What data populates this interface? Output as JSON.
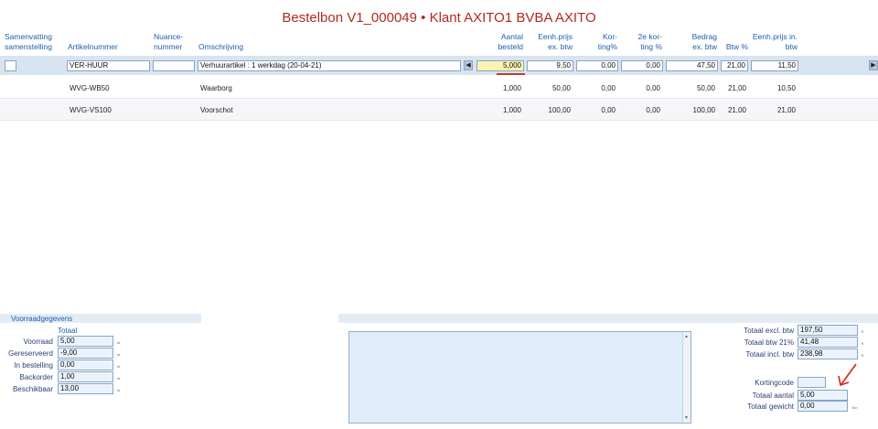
{
  "title": "Bestelbon V1_000049 • Klant AXITO1 BVBA AXITO",
  "columns": {
    "samenvatting": "Samenvatting samenstelling",
    "artikelnummer": "Artikelnummer",
    "nuance": "Nuance-nummer",
    "omschrijving": "Omschrijving",
    "aantal": "Aantal besteld",
    "eenhprijs": "Eenh.prijs ex. btw",
    "korting": "Kor-ting%",
    "korting2": "2e kor-ting %",
    "bedrag": "Bedrag ex. btw",
    "btw": "Btw %",
    "eenhprijs_in": "Eenh.prijs in. btw"
  },
  "subheaders": {
    "samenvatting": "Samenvatting samenstelling",
    "artikelnummer": "Artikelnummer (F5)",
    "nuance": "Nuancenummer",
    "omschrijving": "Omschrijving",
    "aantal": "Aantal besteld",
    "eenhprijs": "Eenh.prijs ex. btw",
    "korting": "Korting%",
    "korting2": "2e korting %",
    "bedrag": "Bedrag ex. btw",
    "btw": "Btw %",
    "eenhprijs_in": "Eenh.prijs in. btw"
  },
  "edit_row": {
    "artikelnummer": "VER-HUUR",
    "nuance": "",
    "omschrijving": "Verhuurartikel : 1 werkdag (20-04-21)",
    "aantal": "5,000",
    "eenhprijs": "9,50",
    "korting": "0,00",
    "korting2": "0,00",
    "bedrag": "47,50",
    "btw": "21,00",
    "eenhprijs_in": "11,50"
  },
  "rows": [
    {
      "artikelnummer": "WVG-WB50",
      "omschrijving": "Waarborg",
      "aantal": "1,000",
      "eenhprijs": "50,00",
      "korting": "0,00",
      "korting2": "0,00",
      "bedrag": "50,00",
      "btw": "21,00",
      "eenhprijs_in": "10,50"
    },
    {
      "artikelnummer": "WVG-VS100",
      "omschrijving": "Voorschot",
      "aantal": "1,000",
      "eenhprijs": "100,00",
      "korting": "0,00",
      "korting2": "0,00",
      "bedrag": "100,00",
      "btw": "21,00",
      "eenhprijs_in": "21,00"
    }
  ],
  "stock": {
    "panel_title": "Voorraadgegevens",
    "column_title": "Totaal",
    "items": [
      {
        "label": "Voorraad",
        "value": "5,00",
        "unit": "st"
      },
      {
        "label": "Gereserveerd",
        "value": "-9,00",
        "unit": "st"
      },
      {
        "label": "In bestelling",
        "value": "0,00",
        "unit": "st"
      },
      {
        "label": "Backorder",
        "value": "1,00",
        "unit": "st"
      },
      {
        "label": "Beschikbaar",
        "value": "13,00",
        "unit": "st"
      }
    ]
  },
  "totals": {
    "excl_label": "Totaal excl. btw",
    "excl_value": "197,50",
    "excl_unit": "€",
    "btw_label": "Totaal btw 21%",
    "btw_value": "41,48",
    "btw_unit": "€",
    "incl_label": "Totaal incl. btw",
    "incl_value": "238,98",
    "incl_unit": "€",
    "kortingcode_label": "Kortingcode",
    "kortingcode_value": "",
    "aantal_label": "Totaal aantal",
    "aantal_value": "5,00",
    "gewicht_label": "Totaal gewicht",
    "gewicht_value": "0,00",
    "gewicht_unit": "Ton"
  },
  "colors": {
    "title": "#b02a1f",
    "header": "#1f5fa8",
    "annotation_arrow": "#d9221a",
    "underline": "#c0392b"
  }
}
